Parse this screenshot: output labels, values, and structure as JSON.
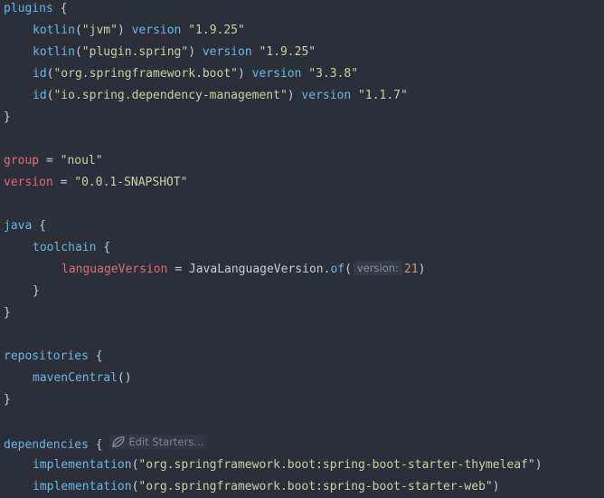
{
  "code": {
    "l1": {
      "kw": "plugins",
      "brace": " {"
    },
    "l2": {
      "fn": "kotlin",
      "open": "(",
      "arg": "\"jvm\"",
      "close": ")",
      "kw": " version ",
      "val": "\"1.9.25\""
    },
    "l3": {
      "fn": "kotlin",
      "open": "(",
      "arg": "\"plugin.spring\"",
      "close": ")",
      "kw": " version ",
      "val": "\"1.9.25\""
    },
    "l4": {
      "fn": "id",
      "open": "(",
      "arg": "\"org.springframework.boot\"",
      "close": ")",
      "kw": " version ",
      "val": "\"3.3.8\""
    },
    "l5": {
      "fn": "id",
      "open": "(",
      "arg": "\"io.spring.dependency-management\"",
      "close": ")",
      "kw": " version ",
      "val": "\"1.1.7\""
    },
    "l6": {
      "brace": "}"
    },
    "l8": {
      "prop": "group",
      "op": " = ",
      "val": "\"noul\""
    },
    "l9": {
      "prop": "version",
      "op": " = ",
      "val": "\"0.0.1-SNAPSHOT\""
    },
    "l11": {
      "kw": "java",
      "brace": " {"
    },
    "l12": {
      "kw": "toolchain",
      "brace": " {"
    },
    "l13": {
      "prop": "languageVersion",
      "op": " = ",
      "cls": "JavaLanguageVersion",
      "dot": ".",
      "fn": "of",
      "open": "(",
      "hint": "version:",
      "num": "21",
      "close": ")"
    },
    "l14": {
      "brace": "}"
    },
    "l15": {
      "brace": "}"
    },
    "l17": {
      "kw": "repositories",
      "brace": " {"
    },
    "l18": {
      "fn": "mavenCentral",
      "parens": "()"
    },
    "l19": {
      "brace": "}"
    },
    "l21": {
      "kw": "dependencies",
      "brace": " { ",
      "starters": "Edit Starters..."
    },
    "l22": {
      "fn": "implementation",
      "open": "(",
      "arg": "\"org.springframework.boot:spring-boot-starter-thymeleaf\"",
      "close": ")"
    },
    "l23": {
      "fn": "implementation",
      "open": "(",
      "arg": "\"org.springframework.boot:spring-boot-starter-web\"",
      "close": ")"
    }
  },
  "colors": {
    "background": "#2b2f3a",
    "keyword": "#6cb6e3",
    "string": "#c9d1a4",
    "property": "#e06c75",
    "number": "#d19a66"
  },
  "icons": {
    "starters": "spring-leaf-icon"
  }
}
